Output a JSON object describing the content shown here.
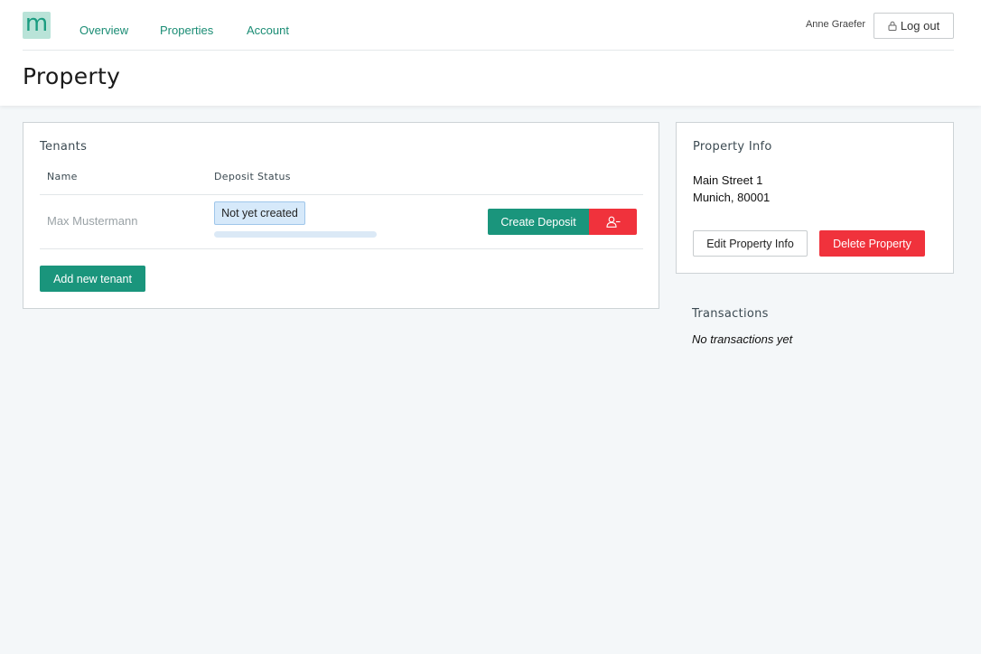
{
  "header": {
    "logo_text": "m",
    "nav": [
      {
        "label": "Overview"
      },
      {
        "label": "Properties"
      },
      {
        "label": "Account"
      }
    ],
    "username": "Anne Graefer",
    "logout_label": "Log out",
    "logout_icon": "lock-icon"
  },
  "page": {
    "title": "Property"
  },
  "tenants": {
    "title": "Tenants",
    "columns": [
      "Name",
      "Deposit Status"
    ],
    "rows": [
      {
        "name": "Max Mustermann",
        "status": "Not yet created",
        "progress_percent": 0,
        "create_label": "Create Deposit",
        "remove_icon": "remove-user-icon"
      }
    ],
    "add_label": "Add new tenant"
  },
  "property_info": {
    "title": "Property Info",
    "address_line1": "Main Street 1",
    "address_line2": "Munich, 80001",
    "edit_label": "Edit Property Info",
    "delete_label": "Delete Property"
  },
  "transactions": {
    "title": "Transactions",
    "empty_text": "No transactions yet"
  },
  "colors": {
    "brand_green": "#1a957c",
    "danger_red": "#f0323c",
    "badge_blue": "#d6e9fa",
    "background": "#f4f7f9"
  }
}
